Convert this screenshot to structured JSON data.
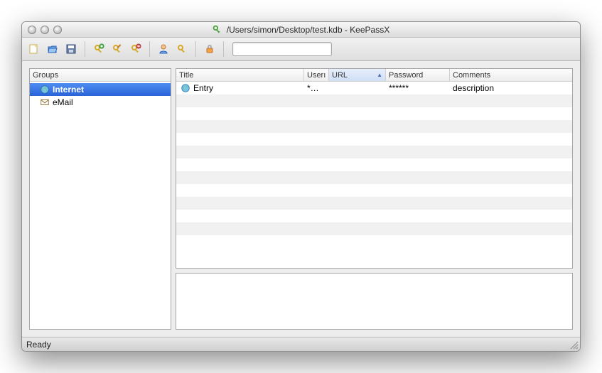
{
  "title": "/Users/simon/Desktop/test.kdb - KeePassX",
  "statusbar": {
    "text": "Ready"
  },
  "search": {
    "value": ""
  },
  "groups": {
    "header": "Groups",
    "items": [
      {
        "label": "Internet",
        "icon": "globe",
        "selected": true
      },
      {
        "label": "eMail",
        "icon": "envelope",
        "selected": false
      }
    ]
  },
  "entries": {
    "columns": {
      "title": "Title",
      "username": "Userı",
      "url": "URL",
      "password": "Password",
      "comments": "Comments"
    },
    "sort_column": "url",
    "rows": [
      {
        "title": "Entry",
        "username": "*…",
        "url": "",
        "password": "******",
        "comments": "description"
      }
    ]
  }
}
